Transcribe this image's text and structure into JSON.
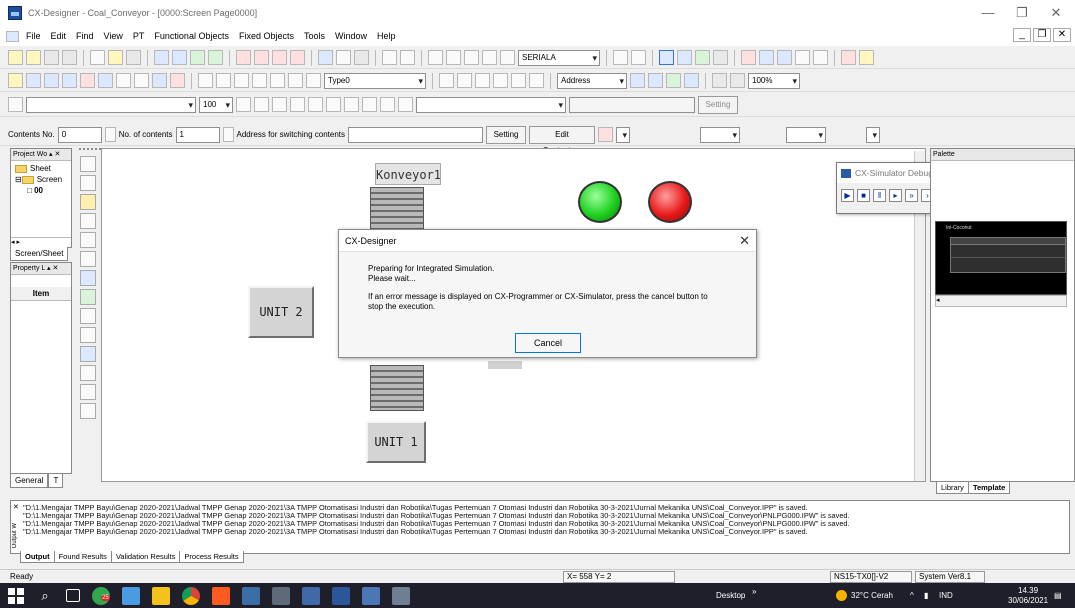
{
  "window": {
    "title": "CX-Designer - Coal_Conveyor - [0000:Screen Page0000]"
  },
  "menu": {
    "items": [
      "File",
      "Edit",
      "Find",
      "View",
      "PT",
      "Functional Objects",
      "Fixed Objects",
      "Tools",
      "Window",
      "Help"
    ]
  },
  "toolbar": {
    "serial_combo": "SERIALA",
    "type_combo": "Type0",
    "address_combo": "Address",
    "zoom_combo": "100%",
    "font_size": "100",
    "setting_label": "Setting"
  },
  "contents_bar": {
    "contents_no_label": "Contents No.",
    "contents_no_value": "0",
    "no_of_contents_label": "No. of contents",
    "no_of_contents_value": "1",
    "address_label": "Address for switching contents",
    "setting_button": "Setting",
    "edit_button": "Edit Contents..."
  },
  "project_workspace": {
    "header": "Project Wo",
    "tree": [
      "Sheet",
      "Screen",
      "00"
    ],
    "tab": "Screen/Sheet"
  },
  "property_list": {
    "header": "Property L",
    "item_column": "Item",
    "tab_general": "General",
    "tab_t": "T"
  },
  "screen": {
    "konveyor_label": "Konveyor1",
    "unit2": "UNIT 2",
    "unit1": "UNIT 1",
    "lamp_green": "#1fd11f",
    "lamp_red": "#e81a1a"
  },
  "dialog": {
    "title": "CX-Designer",
    "line1": "Preparing for Integrated Simulation.",
    "line2": "Please wait...",
    "line3": "If an error message is displayed on CX-Programmer or CX-Simulator, press the cancel button to",
    "line4": "stop the execution.",
    "cancel": "Cancel"
  },
  "simulator": {
    "title": "CX-Simulator Debug ..."
  },
  "palette": {
    "header": "Palette",
    "tab_library": "Library",
    "tab_template": "Template",
    "preview_title": "Ini-Coconut"
  },
  "output": {
    "lines": [
      "\"D:\\1.Mengajar TMPP Bayu\\Genap 2020-2021\\Jadwal TMPP Genap 2020-2021\\3A TMPP Otomatisasi Industri dan Robotika\\Tugas Pertemuan 7 Otomasi Industri dan Robotika 30-3-2021\\Jurnal Mekanika UNS\\Coal_Conveyor.IPP\" is saved.",
      "\"D:\\1.Mengajar TMPP Bayu\\Genap 2020-2021\\Jadwal TMPP Genap 2020-2021\\3A TMPP Otomatisasi Industri dan Robotika\\Tugas Pertemuan 7 Otomasi Industri dan Robotika 30-3-2021\\Jurnal Mekanika UNS\\Coal_Conveyor\\PNLPG000.IPW\" is saved.",
      "\"D:\\1.Mengajar TMPP Bayu\\Genap 2020-2021\\Jadwal TMPP Genap 2020-2021\\3A TMPP Otomatisasi Industri dan Robotika\\Tugas Pertemuan 7 Otomasi Industri dan Robotika 30-3-2021\\Jurnal Mekanika UNS\\Coal_Conveyor\\PNLPG000.IPW\" is saved.",
      "\"D:\\1.Mengajar TMPP Bayu\\Genap 2020-2021\\Jadwal TMPP Genap 2020-2021\\3A TMPP Otomatisasi Industri dan Robotika\\Tugas Pertemuan 7 Otomasi Industri dan Robotika 30-3-2021\\Jurnal Mekanika UNS\\Coal_Conveyor.IPP\" is saved."
    ],
    "tabs": [
      "Output",
      "Found Results",
      "Validation Results",
      "Process Results"
    ],
    "side_label": "Output W"
  },
  "status": {
    "ready": "Ready",
    "coords": "X= 558 Y= 2",
    "model": "NS15-TX0[]-V2",
    "version": "System Ver8.1"
  },
  "taskbar": {
    "desktop": "Desktop",
    "chevron": "»",
    "weather": "32°C Cerah",
    "lang": "IND",
    "time": "14.39",
    "date": "30/06/2021",
    "badge": "25"
  }
}
